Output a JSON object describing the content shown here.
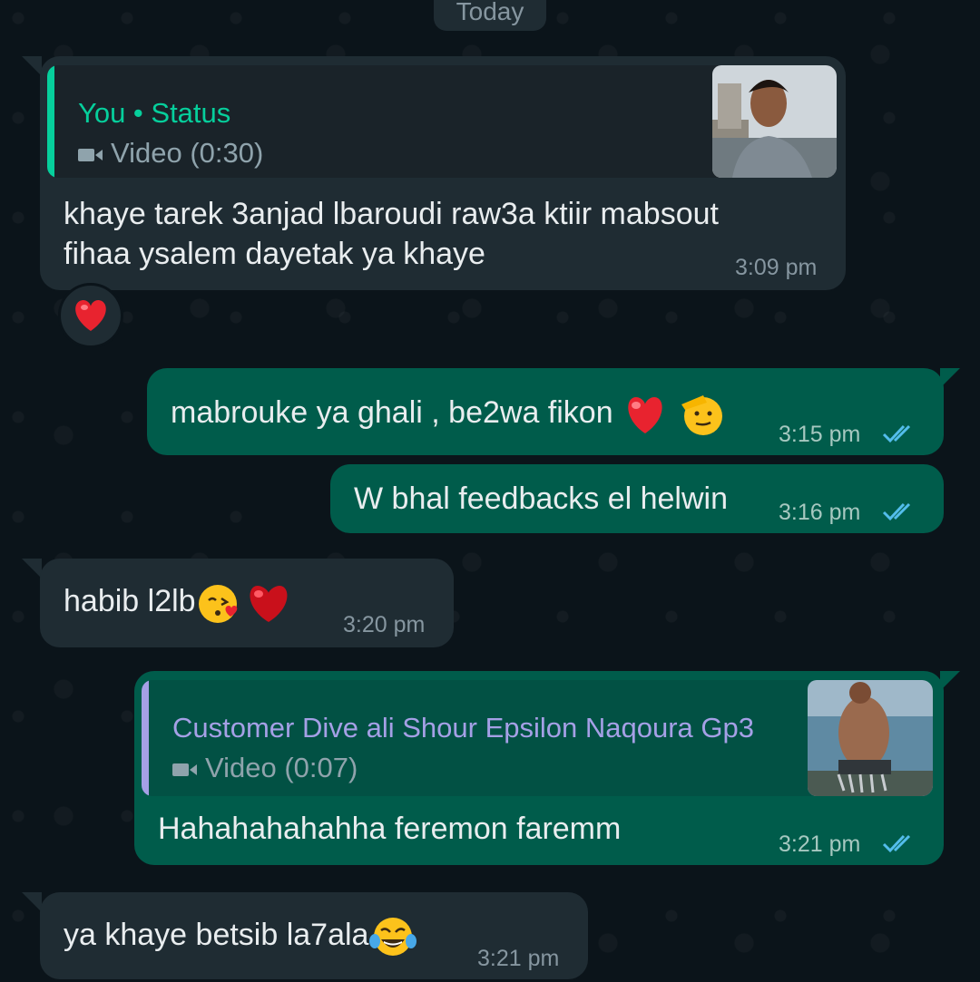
{
  "chat": {
    "date_label": "Today",
    "messages": [
      {
        "direction": "incoming",
        "quote": {
          "author": "You • Status",
          "type_label": "Video (0:30)",
          "author_color": "#06cf9c"
        },
        "lines": [
          "khaye tarek 3anjad lbaroudi raw3a ktiir mabsout",
          "fihaa ysalem dayetak ya khaye"
        ],
        "time": "3:09 pm",
        "reaction": "heart-emoji"
      },
      {
        "direction": "outgoing",
        "text": "mabrouke ya ghali , be2wa fikon",
        "emojis": [
          "red-heart-emoji",
          "saluting-face-emoji"
        ],
        "time": "3:15 pm",
        "status": "read"
      },
      {
        "direction": "outgoing",
        "text": "W bhal feedbacks el helwin",
        "time": "3:16 pm",
        "status": "read"
      },
      {
        "direction": "incoming",
        "text": "habib l2lb",
        "emojis": [
          "face-blowing-kiss-emoji",
          "red-heart-emoji"
        ],
        "time": "3:20 pm"
      },
      {
        "direction": "outgoing",
        "quote": {
          "author": "Customer Dive ali Shour Epsilon Naqoura Gp3",
          "type_label": "Video (0:07)",
          "author_color": "#a5a0e6"
        },
        "text": "Hahahahahahha feremon faremm",
        "time": "3:21 pm",
        "status": "read"
      },
      {
        "direction": "incoming",
        "text": "ya khaye betsib la7ala",
        "emojis": [
          "face-with-tears-of-joy-emoji"
        ],
        "time": "3:21 pm"
      }
    ]
  },
  "colors": {
    "background": "#0b141a",
    "incoming_bubble": "#1f2c33",
    "outgoing_bubble": "#005c4b",
    "read_ticks": "#53bdeb"
  }
}
